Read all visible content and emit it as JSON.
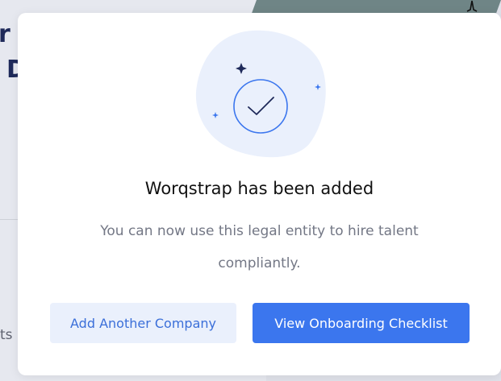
{
  "background": {
    "heading_line1": "r f",
    "heading_line2": "D",
    "side_text": "ts"
  },
  "modal": {
    "title": "Worqstrap has been added",
    "body": "You can now use this legal entity to hire talent compliantly.",
    "illustration_icon": "checkmark-circle-icon",
    "buttons": {
      "secondary_label": "Add Another Company",
      "primary_label": "View Onboarding Checklist"
    }
  },
  "colors": {
    "accent": "#3b76ee",
    "secondary_button_bg": "#eaf0fc",
    "secondary_button_text": "#3b6fd9",
    "illustration_blob": "#eaf0fc",
    "sparkle_dark": "#1f2a5a",
    "sparkle_blue": "#3b76ee"
  }
}
